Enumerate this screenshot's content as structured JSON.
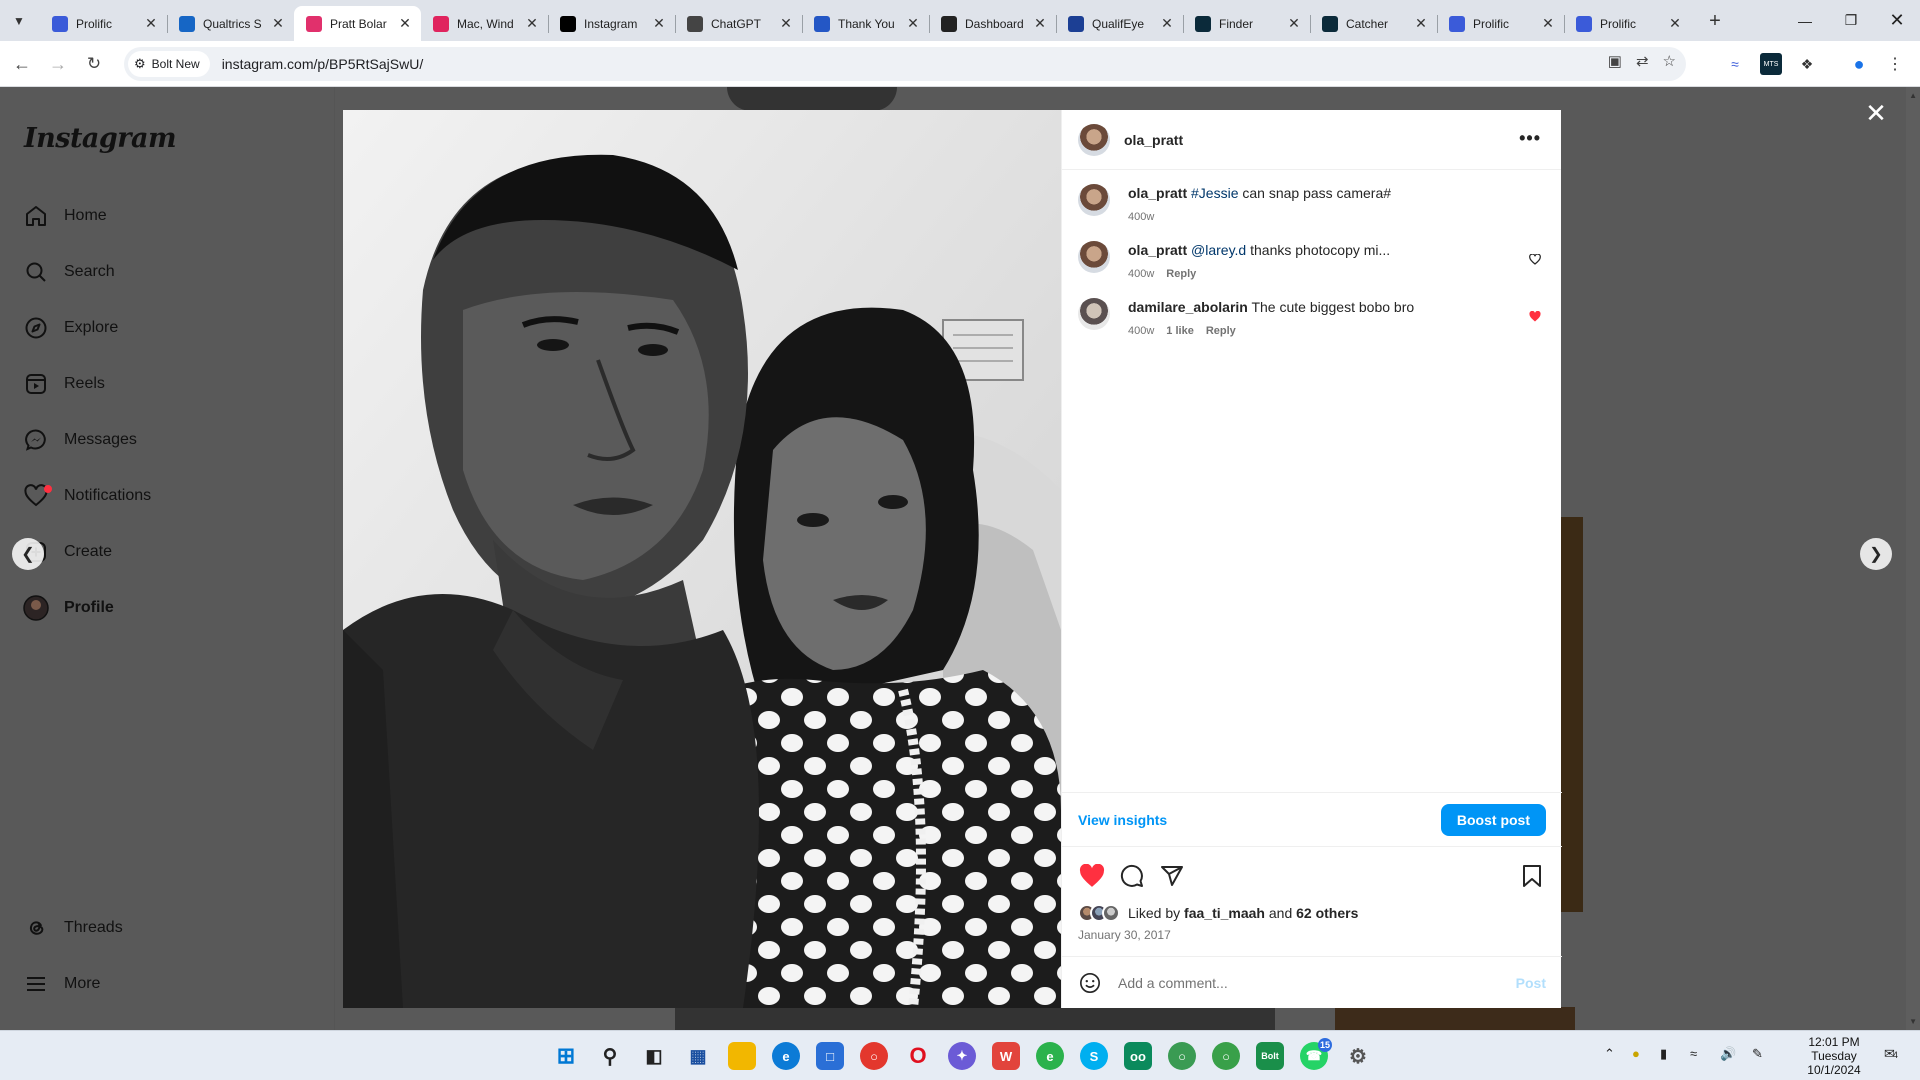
{
  "browser": {
    "tabs": [
      {
        "title": "Prolific",
        "favicon": "prolific-icon",
        "color": "#3b5bd9"
      },
      {
        "title": "Qualtrics S",
        "favicon": "qualtrics-icon",
        "color": "#1666c5"
      },
      {
        "title": "Pratt Bolar",
        "favicon": "instagram-icon",
        "color": "#e1306c",
        "active": true
      },
      {
        "title": "Mac, Wind",
        "favicon": "pc-icon",
        "color": "#e0245e"
      },
      {
        "title": "Instagram",
        "favicon": "medium-icon",
        "color": "#000000"
      },
      {
        "title": "ChatGPT",
        "favicon": "chatgpt-icon",
        "color": "#444444"
      },
      {
        "title": "Thank You",
        "favicon": "prolific-a-icon",
        "color": "#2457c5"
      },
      {
        "title": "Dashboard",
        "favicon": "amazon-icon",
        "color": "#222222"
      },
      {
        "title": "QualifEye",
        "favicon": "qualifeye-icon",
        "color": "#1c3f94"
      },
      {
        "title": "Finder",
        "favicon": "mts-icon",
        "color": "#0b2a3a"
      },
      {
        "title": "Catcher",
        "favicon": "mts-icon",
        "color": "#0b2a3a"
      },
      {
        "title": "Prolific",
        "favicon": "prolific-icon",
        "color": "#3b5bd9"
      },
      {
        "title": "Prolific",
        "favicon": "prolific-icon",
        "color": "#3b5bd9"
      }
    ],
    "bolt_chip": "Bolt New",
    "url": "instagram.com/p/BP5RtSajSwU/"
  },
  "instagram": {
    "logo": "Instagram",
    "nav": [
      {
        "label": "Home",
        "icon": "home-icon"
      },
      {
        "label": "Search",
        "icon": "search-icon"
      },
      {
        "label": "Explore",
        "icon": "explore-icon"
      },
      {
        "label": "Reels",
        "icon": "reels-icon"
      },
      {
        "label": "Messages",
        "icon": "messenger-icon"
      },
      {
        "label": "Notifications",
        "icon": "heart-icon"
      },
      {
        "label": "Create",
        "icon": "create-icon"
      },
      {
        "label": "Profile",
        "icon": "avatar-icon"
      }
    ],
    "nav_bottom": [
      {
        "label": "Threads",
        "icon": "threads-icon"
      },
      {
        "label": "More",
        "icon": "menu-icon"
      }
    ]
  },
  "post": {
    "username": "ola_pratt",
    "comments": [
      {
        "user": "ola_pratt",
        "link": "#Jessie",
        "text": " can snap pass camera#",
        "age": "400w",
        "likes": "",
        "reply": "",
        "liked": null
      },
      {
        "user": "ola_pratt",
        "link": "@larey.d",
        "text": " thanks photocopy mi...",
        "age": "400w",
        "likes": "",
        "reply": "Reply",
        "liked": false
      },
      {
        "user": "damilare_abolarin",
        "link": "",
        "text": "The cute biggest bobo bro",
        "age": "400w",
        "likes": "1 like",
        "reply": "Reply",
        "liked": true
      }
    ],
    "view_insights": "View insights",
    "boost_post": "Boost post",
    "liked_by_prefix": "Liked by ",
    "liked_by_user": "faa_ti_maah",
    "liked_by_mid": " and ",
    "liked_by_others": "62 others",
    "date": "January 30, 2017",
    "comment_placeholder": "Add a comment...",
    "post_label": "Post",
    "accent": "#0095f6",
    "heart_color": "#ff3040"
  },
  "taskbar": {
    "time": "12:01 PM",
    "day": "Tuesday",
    "date": "10/1/2024",
    "whatsapp_badge": "15",
    "notification_count": "4"
  }
}
